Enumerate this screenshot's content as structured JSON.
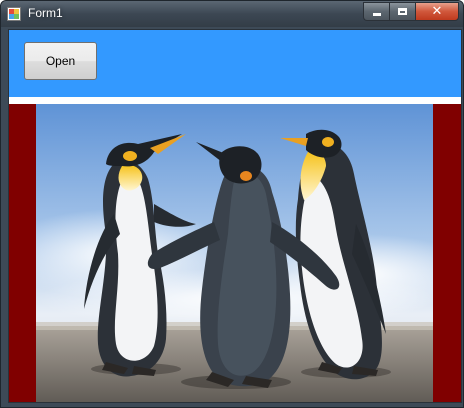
{
  "window": {
    "title": "Form1",
    "app_icon": "winforms-app-icon"
  },
  "caption_buttons": [
    {
      "name": "minimize-button",
      "icon": "minimize-icon"
    },
    {
      "name": "maximize-button",
      "icon": "maximize-icon"
    },
    {
      "name": "close-button",
      "icon": "close-icon"
    }
  ],
  "toolbar": {
    "open_label": "Open"
  },
  "picture": {
    "subject": "penguins-photo"
  },
  "colors": {
    "panel": "#3399ff",
    "picture_background": "#800000",
    "title_bar": "#3c4753",
    "close_button": "#c8462a"
  }
}
